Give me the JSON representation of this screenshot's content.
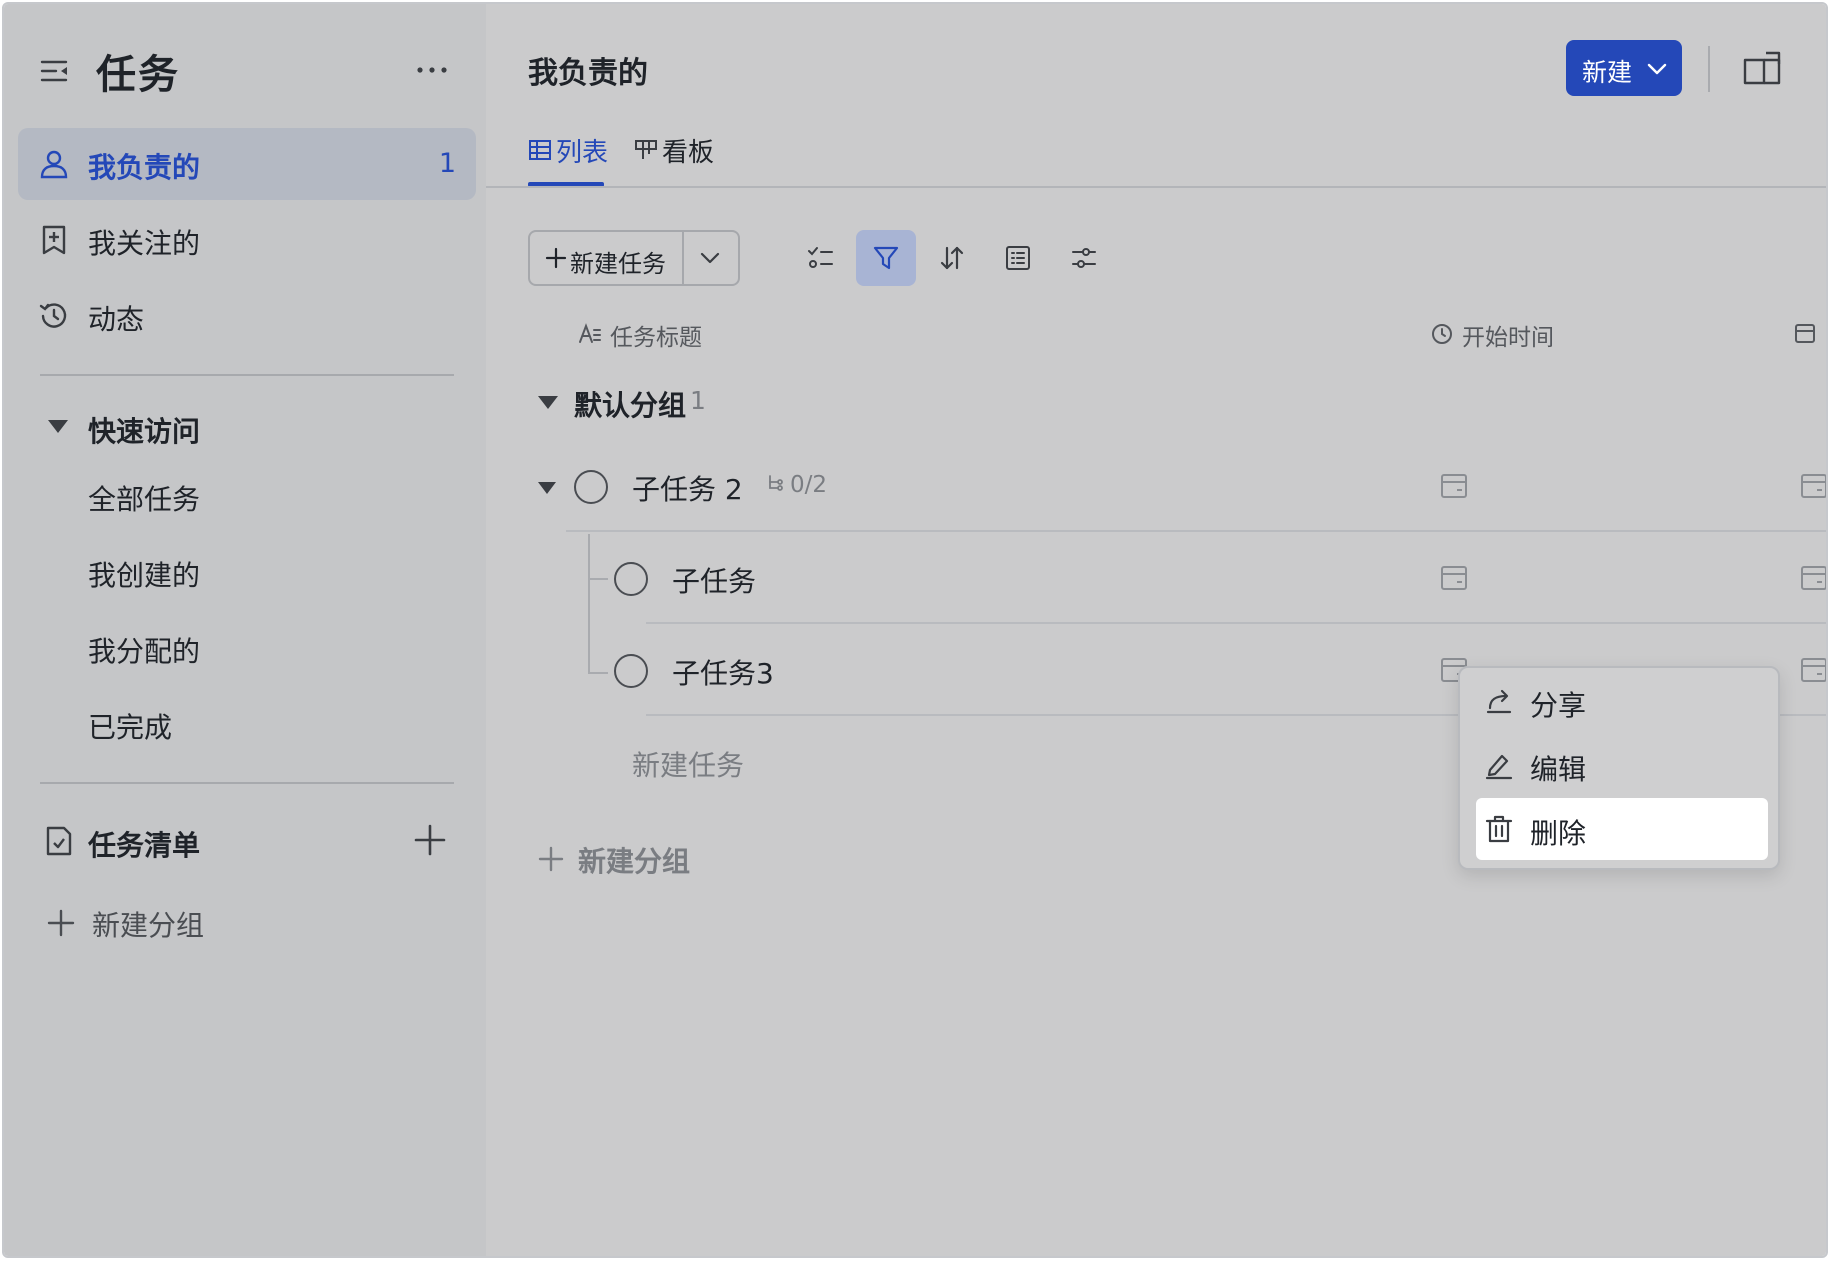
{
  "sidebar": {
    "title": "任务",
    "nav": [
      {
        "label": "我负责的",
        "count": "1",
        "icon": "person-icon"
      },
      {
        "label": "我关注的",
        "icon": "bookmark-icon"
      },
      {
        "label": "动态",
        "icon": "history-icon"
      }
    ],
    "quick_access": {
      "title": "快速访问",
      "items": [
        "全部任务",
        "我创建的",
        "我分配的",
        "已完成"
      ]
    },
    "task_list": {
      "title": "任务清单"
    },
    "new_group": "新建分组"
  },
  "main": {
    "title": "我负责的",
    "new_button": "新建",
    "tabs": [
      {
        "label": "列表",
        "icon": "table-icon"
      },
      {
        "label": "看板",
        "icon": "kanban-icon"
      }
    ],
    "toolbar": {
      "new_task": "新建任务"
    },
    "columns": {
      "title": "任务标题",
      "start_time": "开始时间"
    },
    "group": {
      "name": "默认分组",
      "count": "1"
    },
    "tasks": [
      {
        "title": "子任务 2",
        "subtasks": "0/2"
      },
      {
        "title": "子任务"
      },
      {
        "title": "子任务3"
      }
    ],
    "add_task": "新建任务",
    "add_group": "新建分组"
  },
  "context_menu": {
    "items": [
      {
        "label": "分享",
        "icon": "share-icon"
      },
      {
        "label": "编辑",
        "icon": "edit-icon"
      },
      {
        "label": "删除",
        "icon": "trash-icon"
      }
    ]
  },
  "colors": {
    "accent": "#2448b8",
    "sidebar_bg": "#c5c6c8",
    "main_bg": "#cbcbcc"
  }
}
